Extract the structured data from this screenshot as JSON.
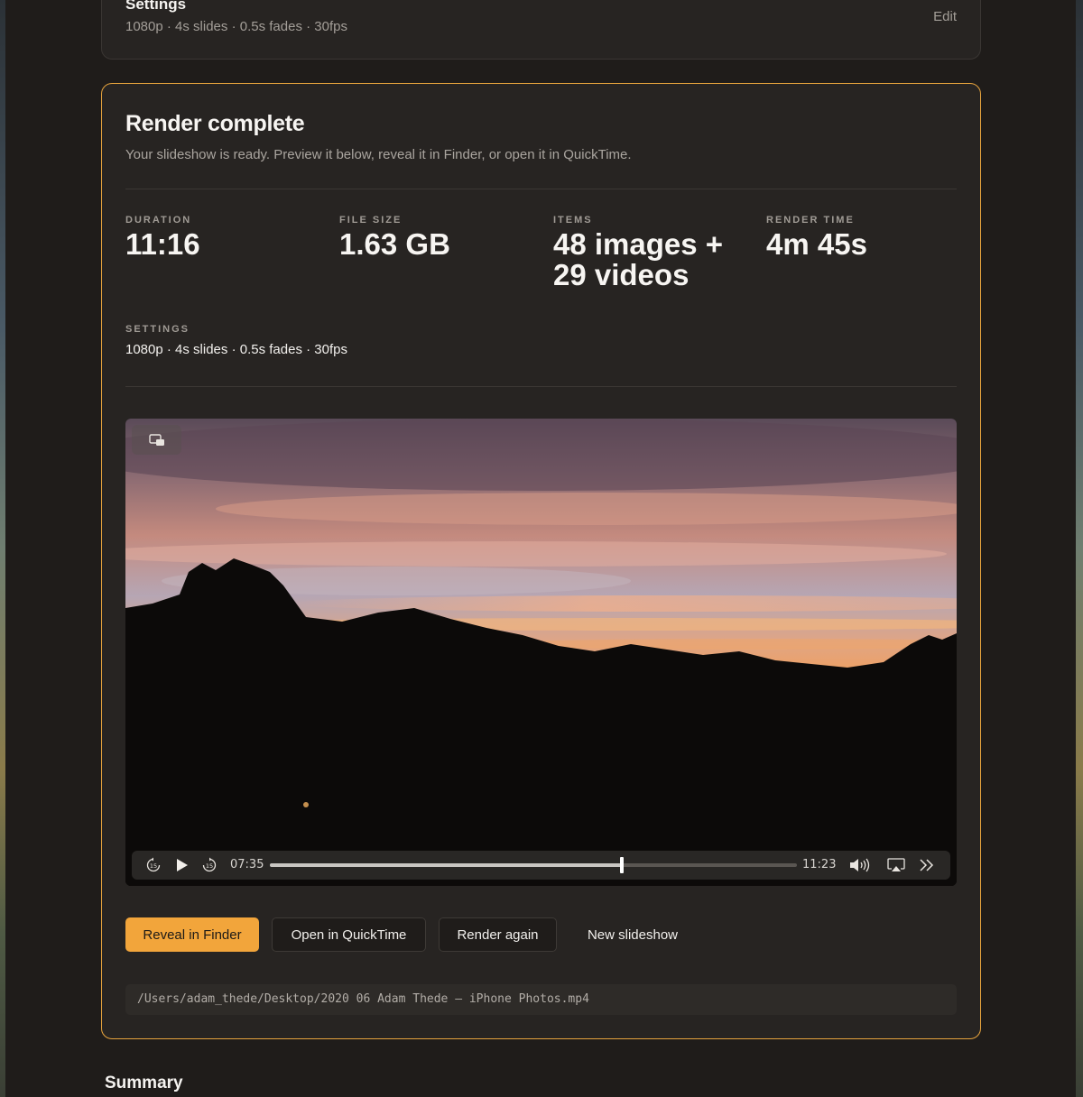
{
  "settings_card": {
    "title": "Settings",
    "subtitle": "1080p · 4s slides · 0.5s fades · 30fps",
    "edit_label": "Edit"
  },
  "render": {
    "title": "Render complete",
    "description": "Your slideshow is ready. Preview it below, reveal it in Finder, or open it in QuickTime.",
    "stats": [
      {
        "label": "DURATION",
        "value": "11:16"
      },
      {
        "label": "FILE SIZE",
        "value": "1.63 GB"
      },
      {
        "label": "ITEMS",
        "value": "48 images + 29 videos"
      },
      {
        "label": "RENDER TIME",
        "value": "4m 45s"
      }
    ],
    "settings_label": "SETTINGS",
    "settings_value": "1080p · 4s slides · 0.5s fades · 30fps"
  },
  "player": {
    "current_time": "07:35",
    "total_time": "11:23",
    "progress": 0.667,
    "icons": [
      "pip-icon",
      "skip-back-15-icon",
      "play-icon",
      "skip-forward-15-icon",
      "volume-icon",
      "airplay-icon",
      "more-controls-icon"
    ],
    "skip_seconds": "15"
  },
  "actions": {
    "reveal": "Reveal in Finder",
    "quicktime": "Open in QuickTime",
    "render_again": "Render again",
    "new_slideshow": "New slideshow"
  },
  "output_path": "/Users/adam_thede/Desktop/2020 06 Adam Thede – iPhone Photos.mp4",
  "summary_title": "Summary",
  "colors": {
    "accent": "#f2a53b",
    "card_bg": "#272422",
    "window_bg": "#1f1c1a"
  }
}
